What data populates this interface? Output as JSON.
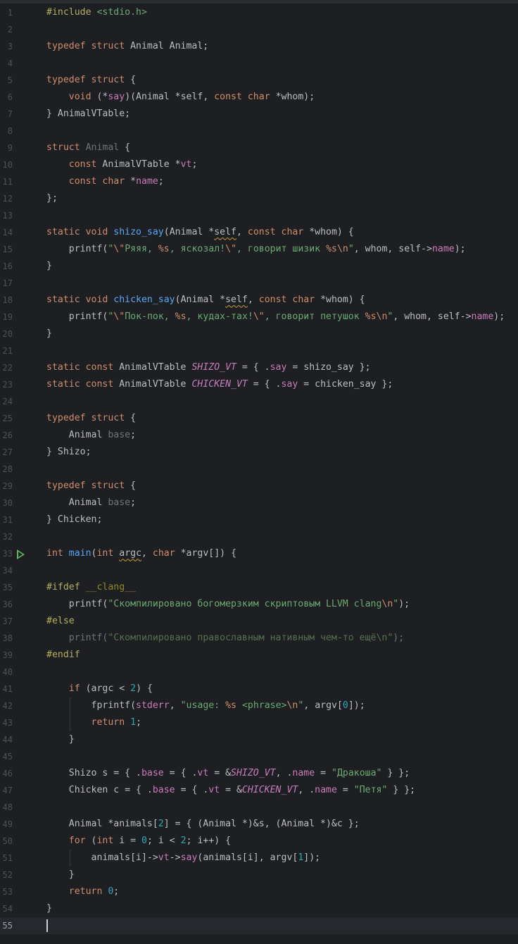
{
  "editor": {
    "current_line": 55,
    "lines": [
      {
        "n": "1",
        "t": [
          [
            "pp",
            "#include "
          ],
          [
            "str",
            "<stdio.h>"
          ]
        ]
      },
      {
        "n": "2",
        "t": []
      },
      {
        "n": "3",
        "t": [
          [
            "kw",
            "typedef struct "
          ],
          [
            "",
            "Animal Animal;"
          ]
        ]
      },
      {
        "n": "4",
        "t": []
      },
      {
        "n": "5",
        "t": [
          [
            "kw",
            "typedef struct "
          ],
          [
            "",
            "{"
          ]
        ]
      },
      {
        "n": "6",
        "t": [
          [
            "",
            "    "
          ],
          [
            "kw",
            "void "
          ],
          [
            "",
            "(*"
          ],
          [
            "mem",
            "say"
          ],
          [
            "",
            ")(Animal *self, "
          ],
          [
            "kw",
            "const char "
          ],
          [
            "",
            "*whom);"
          ]
        ]
      },
      {
        "n": "7",
        "t": [
          [
            "",
            "} AnimalVTable;"
          ]
        ]
      },
      {
        "n": "8",
        "t": []
      },
      {
        "n": "9",
        "t": [
          [
            "kw",
            "struct "
          ],
          [
            "dim",
            "Animal"
          ],
          [
            "",
            " {"
          ]
        ]
      },
      {
        "n": "10",
        "t": [
          [
            "",
            "    "
          ],
          [
            "kw",
            "const "
          ],
          [
            "",
            "AnimalVTable *"
          ],
          [
            "mem",
            "vt"
          ],
          [
            "",
            ";"
          ]
        ]
      },
      {
        "n": "11",
        "t": [
          [
            "",
            "    "
          ],
          [
            "kw",
            "const char "
          ],
          [
            "",
            "*"
          ],
          [
            "mem",
            "name"
          ],
          [
            "",
            ";"
          ]
        ]
      },
      {
        "n": "12",
        "t": [
          [
            "",
            "};"
          ]
        ]
      },
      {
        "n": "13",
        "t": []
      },
      {
        "n": "14",
        "t": [
          [
            "kw",
            "static void "
          ],
          [
            "fn",
            "shizo_say"
          ],
          [
            "",
            "(Animal *"
          ],
          [
            "ul",
            "self"
          ],
          [
            "",
            ", "
          ],
          [
            "kw",
            "const char "
          ],
          [
            "",
            "*whom) {"
          ]
        ]
      },
      {
        "n": "15",
        "t": [
          [
            "",
            "    printf("
          ],
          [
            "str",
            "\""
          ],
          [
            "esc",
            "\\\""
          ],
          [
            "str",
            "Ряяя, "
          ],
          [
            "esc",
            "%s"
          ],
          [
            "str",
            ", яскозал!"
          ],
          [
            "esc",
            "\\\""
          ],
          [
            "str",
            ", говорит шизик "
          ],
          [
            "esc",
            "%s\\n"
          ],
          [
            "str",
            "\""
          ],
          [
            "",
            ", whom, self->"
          ],
          [
            "mem",
            "name"
          ],
          [
            "",
            ");"
          ]
        ]
      },
      {
        "n": "16",
        "t": [
          [
            "",
            "}"
          ]
        ]
      },
      {
        "n": "17",
        "t": []
      },
      {
        "n": "18",
        "t": [
          [
            "kw",
            "static void "
          ],
          [
            "fn",
            "chicken_say"
          ],
          [
            "",
            "(Animal *"
          ],
          [
            "ul",
            "self"
          ],
          [
            "",
            ", "
          ],
          [
            "kw",
            "const char "
          ],
          [
            "",
            "*whom) {"
          ]
        ]
      },
      {
        "n": "19",
        "t": [
          [
            "",
            "    printf("
          ],
          [
            "str",
            "\""
          ],
          [
            "esc",
            "\\\""
          ],
          [
            "str",
            "Пок-пок, "
          ],
          [
            "esc",
            "%s"
          ],
          [
            "str",
            ", кудах-тах!"
          ],
          [
            "esc",
            "\\\""
          ],
          [
            "str",
            ", говорит петушок "
          ],
          [
            "esc",
            "%s\\n"
          ],
          [
            "str",
            "\""
          ],
          [
            "",
            ", whom, self->"
          ],
          [
            "mem",
            "name"
          ],
          [
            "",
            ");"
          ]
        ]
      },
      {
        "n": "20",
        "t": [
          [
            "",
            "}"
          ]
        ]
      },
      {
        "n": "21",
        "t": []
      },
      {
        "n": "22",
        "t": [
          [
            "kw",
            "static const "
          ],
          [
            "",
            "AnimalVTable "
          ],
          [
            "cst",
            "SHIZO_VT"
          ],
          [
            "",
            " = { ."
          ],
          [
            "mem",
            "say"
          ],
          [
            "",
            " = shizo_say };"
          ]
        ]
      },
      {
        "n": "23",
        "t": [
          [
            "kw",
            "static const "
          ],
          [
            "",
            "AnimalVTable "
          ],
          [
            "cst",
            "CHICKEN_VT"
          ],
          [
            "",
            " = { ."
          ],
          [
            "mem",
            "say"
          ],
          [
            "",
            " = chicken_say };"
          ]
        ]
      },
      {
        "n": "24",
        "t": []
      },
      {
        "n": "25",
        "t": [
          [
            "kw",
            "typedef struct "
          ],
          [
            "",
            "{"
          ]
        ]
      },
      {
        "n": "26",
        "t": [
          [
            "",
            "    Animal "
          ],
          [
            "dim",
            "base"
          ],
          [
            "",
            ";"
          ]
        ]
      },
      {
        "n": "27",
        "t": [
          [
            "",
            "} Shizo;"
          ]
        ]
      },
      {
        "n": "28",
        "t": []
      },
      {
        "n": "29",
        "t": [
          [
            "kw",
            "typedef struct "
          ],
          [
            "",
            "{"
          ]
        ]
      },
      {
        "n": "30",
        "t": [
          [
            "",
            "    Animal "
          ],
          [
            "dim",
            "base"
          ],
          [
            "",
            ";"
          ]
        ]
      },
      {
        "n": "31",
        "t": [
          [
            "",
            "} Chicken;"
          ]
        ]
      },
      {
        "n": "32",
        "t": []
      },
      {
        "n": "33",
        "t": [
          [
            "kw",
            "int "
          ],
          [
            "fn",
            "main"
          ],
          [
            "",
            "("
          ],
          [
            "kw",
            "int "
          ],
          [
            "ul",
            "argc"
          ],
          [
            "",
            ", "
          ],
          [
            "kw",
            "char "
          ],
          [
            "",
            "*argv[]) {"
          ]
        ]
      },
      {
        "n": "34",
        "t": []
      },
      {
        "n": "35",
        "t": [
          [
            "pp",
            "#ifdef "
          ],
          [
            "mac",
            "__clang__"
          ]
        ]
      },
      {
        "n": "36",
        "t": [
          [
            "",
            "    printf("
          ],
          [
            "str",
            "\"Скомпилировано богомерзким скриптовым LLVM clang"
          ],
          [
            "esc",
            "\\n"
          ],
          [
            "str",
            "\""
          ],
          [
            "",
            ");"
          ]
        ]
      },
      {
        "n": "37",
        "t": [
          [
            "pp",
            "#else"
          ]
        ]
      },
      {
        "n": "38",
        "t": [
          [
            "dim",
            "    printf("
          ],
          [
            "dimstr",
            "\"Скомпилировано православным нативным чем-то ещё\\n\""
          ],
          [
            "dim",
            ");"
          ]
        ]
      },
      {
        "n": "39",
        "t": [
          [
            "pp",
            "#endif"
          ]
        ]
      },
      {
        "n": "40",
        "t": []
      },
      {
        "n": "41",
        "t": [
          [
            "",
            "    "
          ],
          [
            "kw",
            "if "
          ],
          [
            "",
            "(argc < "
          ],
          [
            "num",
            "2"
          ],
          [
            "",
            ") {"
          ]
        ]
      },
      {
        "n": "42",
        "t": [
          [
            "",
            "        fprintf("
          ],
          [
            "mem",
            "stderr"
          ],
          [
            "",
            ", "
          ],
          [
            "str",
            "\"usage: "
          ],
          [
            "esc",
            "%s"
          ],
          [
            "str",
            " <phrase>"
          ],
          [
            "esc",
            "\\n"
          ],
          [
            "str",
            "\""
          ],
          [
            "",
            ", argv["
          ],
          [
            "num",
            "0"
          ],
          [
            "",
            "]);"
          ]
        ]
      },
      {
        "n": "43",
        "t": [
          [
            "",
            "        "
          ],
          [
            "kw",
            "return "
          ],
          [
            "num",
            "1"
          ],
          [
            "",
            ";"
          ]
        ]
      },
      {
        "n": "44",
        "t": [
          [
            "",
            "    }"
          ]
        ]
      },
      {
        "n": "45",
        "t": []
      },
      {
        "n": "46",
        "t": [
          [
            "",
            "    Shizo s = { ."
          ],
          [
            "mem",
            "base"
          ],
          [
            "",
            " = { ."
          ],
          [
            "mem",
            "vt"
          ],
          [
            "",
            " = &"
          ],
          [
            "cst",
            "SHIZO_VT"
          ],
          [
            "",
            ", ."
          ],
          [
            "mem",
            "name"
          ],
          [
            "",
            " = "
          ],
          [
            "str",
            "\"Дракоша\""
          ],
          [
            "",
            " } };"
          ]
        ]
      },
      {
        "n": "47",
        "t": [
          [
            "",
            "    Chicken c = { ."
          ],
          [
            "mem",
            "base"
          ],
          [
            "",
            " = { ."
          ],
          [
            "mem",
            "vt"
          ],
          [
            "",
            " = &"
          ],
          [
            "cst",
            "CHICKEN_VT"
          ],
          [
            "",
            ", ."
          ],
          [
            "mem",
            "name"
          ],
          [
            "",
            " = "
          ],
          [
            "str",
            "\"Петя\""
          ],
          [
            "",
            " } };"
          ]
        ]
      },
      {
        "n": "48",
        "t": []
      },
      {
        "n": "49",
        "t": [
          [
            "",
            "    Animal *animals["
          ],
          [
            "num",
            "2"
          ],
          [
            "",
            "] = { (Animal *)&s, (Animal *)&c };"
          ]
        ]
      },
      {
        "n": "50",
        "t": [
          [
            "",
            "    "
          ],
          [
            "kw",
            "for "
          ],
          [
            "",
            "("
          ],
          [
            "kw",
            "int "
          ],
          [
            "",
            "i = "
          ],
          [
            "num",
            "0"
          ],
          [
            "",
            "; i < "
          ],
          [
            "num",
            "2"
          ],
          [
            "",
            "; i++) {"
          ]
        ]
      },
      {
        "n": "51",
        "t": [
          [
            "",
            "        animals[i]->"
          ],
          [
            "mem",
            "vt"
          ],
          [
            "",
            "->"
          ],
          [
            "mem",
            "say"
          ],
          [
            "",
            "(animals[i], argv["
          ],
          [
            "num",
            "1"
          ],
          [
            "",
            "]);"
          ]
        ]
      },
      {
        "n": "52",
        "t": [
          [
            "",
            "    }"
          ]
        ]
      },
      {
        "n": "53",
        "t": [
          [
            "",
            "    "
          ],
          [
            "kw",
            "return "
          ],
          [
            "num",
            "0"
          ],
          [
            "",
            ";"
          ]
        ]
      },
      {
        "n": "54",
        "t": [
          [
            "",
            "}"
          ]
        ]
      },
      {
        "n": "55",
        "t": []
      }
    ]
  }
}
